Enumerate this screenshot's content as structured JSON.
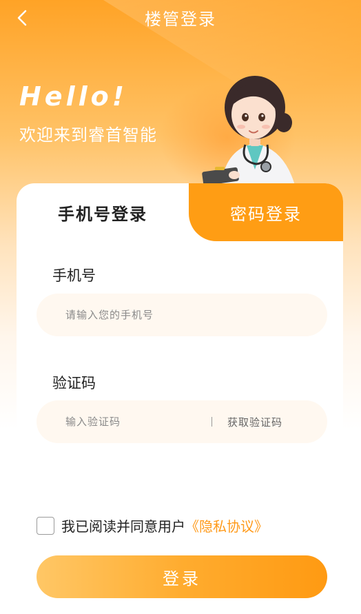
{
  "header": {
    "title": "楼管登录",
    "back_icon": "chevron-left-icon"
  },
  "hero": {
    "greeting": "Hello!",
    "welcome": "欢迎来到睿首智能"
  },
  "tabs": [
    {
      "label": "手机号登录",
      "active": true
    },
    {
      "label": "密码登录",
      "active": false
    }
  ],
  "form": {
    "phone_label": "手机号",
    "phone_placeholder": "请输入您的手机号",
    "code_label": "验证码",
    "code_placeholder": "输入验证码",
    "get_code": "获取验证码"
  },
  "agreement": {
    "text": "我已阅读并同意用户",
    "link": "《隐私协议》",
    "checked": false
  },
  "login_button": "登录",
  "colors": {
    "accent": "#ff9d14",
    "link": "#ff9a1a",
    "field_bg": "#fff8f0"
  }
}
